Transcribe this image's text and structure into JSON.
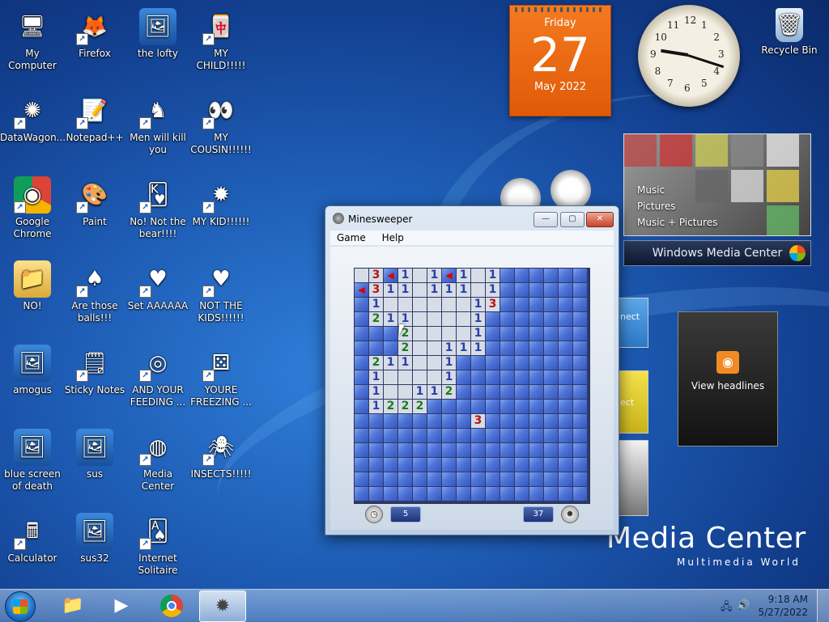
{
  "desktop_icons": [
    {
      "label": "My Computer",
      "icon": "computer-icon",
      "shortcut": false
    },
    {
      "label": "Firefox",
      "icon": "firefox-icon",
      "shortcut": true
    },
    {
      "label": "the lofty",
      "icon": "image-icon",
      "shortcut": false
    },
    {
      "label": "MY CHILD!!!!!",
      "icon": "mahjong-icon",
      "shortcut": true
    },
    {
      "label": "DataWagon...",
      "icon": "network-icon",
      "shortcut": true
    },
    {
      "label": "Notepad++",
      "icon": "notepad-icon",
      "shortcut": true
    },
    {
      "label": "Men will kill you",
      "icon": "chess-icon",
      "shortcut": true
    },
    {
      "label": "MY COUSIN!!!!!!",
      "icon": "eyes-icon",
      "shortcut": true
    },
    {
      "label": "Google Chrome",
      "icon": "chrome-icon",
      "shortcut": true
    },
    {
      "label": "Paint",
      "icon": "paint-icon",
      "shortcut": true
    },
    {
      "label": "No! Not the bear!!!!",
      "icon": "king-card-icon",
      "shortcut": true
    },
    {
      "label": "MY KID!!!!!!",
      "icon": "mine-icon",
      "shortcut": true
    },
    {
      "label": "NO!",
      "icon": "folder-icon",
      "shortcut": false
    },
    {
      "label": "Are those balls!!!",
      "icon": "spades-icon",
      "shortcut": true
    },
    {
      "label": "Set AAAAAA",
      "icon": "hearts-icon",
      "shortcut": true
    },
    {
      "label": "NOT THE KIDS!!!!!!",
      "icon": "hearts-cards-icon",
      "shortcut": true
    },
    {
      "label": "amogus",
      "icon": "image-icon",
      "shortcut": false
    },
    {
      "label": "Sticky Notes",
      "icon": "sticky-notes-icon",
      "shortcut": true
    },
    {
      "label": "AND YOUR FEEDING ...",
      "icon": "game-icon",
      "shortcut": true
    },
    {
      "label": "YOURE FREEZING ...",
      "icon": "dice-icon",
      "shortcut": true
    },
    {
      "label": "blue screen of death",
      "icon": "image-icon",
      "shortcut": false
    },
    {
      "label": "sus",
      "icon": "image-icon",
      "shortcut": false
    },
    {
      "label": "Media Center",
      "icon": "media-center-icon",
      "shortcut": true
    },
    {
      "label": "INSECTS!!!!!",
      "icon": "spider-icon",
      "shortcut": true
    },
    {
      "label": "Calculator",
      "icon": "calculator-icon",
      "shortcut": true
    },
    {
      "label": "sus32",
      "icon": "image-icon",
      "shortcut": false
    },
    {
      "label": "Internet Solitaire",
      "icon": "solitaire-icon",
      "shortcut": true
    }
  ],
  "recycle_bin": {
    "label": "Recycle Bin",
    "icon": "recycle-bin-icon"
  },
  "calendar": {
    "day_of_week": "Friday",
    "day": "27",
    "month_year": "May 2022"
  },
  "clock": {
    "numbers": [
      "12",
      "1",
      "2",
      "3",
      "4",
      "5",
      "6",
      "7",
      "8",
      "9",
      "10",
      "11"
    ],
    "hour": 9,
    "minute": 18
  },
  "media_center_gadget": {
    "items": [
      "Music",
      "Pictures",
      "Music + Pictures"
    ],
    "bar_label": "Windows Media Center"
  },
  "feed_gadget": {
    "label": "View headlines",
    "icon": "rss-icon"
  },
  "partial_gadgets": {
    "connect": "nect",
    "ect": "ect"
  },
  "wallpaper": {
    "title": "Media Center",
    "subtitle": "Multimedia World"
  },
  "minesweeper": {
    "title": "Minesweeper",
    "menu": [
      "Game",
      "Help"
    ],
    "buttons": {
      "minimize": "—",
      "maximize": "▢",
      "close": "✕"
    },
    "time": "5",
    "mines": "37",
    "rows": [
      "o3f1.o1f1.o1.......",
      "f3111.111o1......."
    ],
    "grid": [
      [
        "o",
        "3",
        "f",
        "1",
        "o",
        "1",
        "f",
        "1",
        "o",
        "1",
        "h",
        "h",
        "h",
        "h",
        "h",
        "h"
      ],
      [
        "f",
        "3",
        "1",
        "1",
        "o",
        "1",
        "1",
        "1",
        "o",
        "1",
        "h",
        "h",
        "h",
        "h",
        "h",
        "h"
      ],
      [
        "h",
        "1",
        "o",
        "o",
        "o",
        "o",
        "o",
        "o",
        "1",
        "3",
        "h",
        "h",
        "h",
        "h",
        "h",
        "h"
      ],
      [
        "h",
        "2",
        "1",
        "1",
        "o",
        "o",
        "o",
        "o",
        "1",
        "h",
        "h",
        "h",
        "h",
        "h",
        "h",
        "h"
      ],
      [
        "h",
        "h",
        "h",
        "2",
        "o",
        "o",
        "o",
        "o",
        "1",
        "h",
        "h",
        "h",
        "h",
        "h",
        "h",
        "h"
      ],
      [
        "h",
        "h",
        "h",
        "2",
        "o",
        "o",
        "1",
        "1",
        "1",
        "h",
        "h",
        "h",
        "h",
        "h",
        "h",
        "h"
      ],
      [
        "h",
        "2",
        "1",
        "1",
        "o",
        "o",
        "1",
        "h",
        "h",
        "h",
        "h",
        "h",
        "h",
        "h",
        "h",
        "h"
      ],
      [
        "h",
        "1",
        "o",
        "o",
        "o",
        "o",
        "1",
        "h",
        "h",
        "h",
        "h",
        "h",
        "h",
        "h",
        "h",
        "h"
      ],
      [
        "h",
        "1",
        "o",
        "o",
        "1",
        "1",
        "2",
        "h",
        "h",
        "h",
        "h",
        "h",
        "h",
        "h",
        "h",
        "h"
      ],
      [
        "h",
        "1",
        "2",
        "2",
        "2",
        "h",
        "h",
        "h",
        "h",
        "h",
        "h",
        "h",
        "h",
        "h",
        "h",
        "h"
      ],
      [
        "h",
        "h",
        "h",
        "h",
        "h",
        "h",
        "h",
        "h",
        "3",
        "h",
        "h",
        "h",
        "h",
        "h",
        "h",
        "h"
      ],
      [
        "h",
        "h",
        "h",
        "h",
        "h",
        "h",
        "h",
        "h",
        "h",
        "h",
        "h",
        "h",
        "h",
        "h",
        "h",
        "h"
      ],
      [
        "h",
        "h",
        "h",
        "h",
        "h",
        "h",
        "h",
        "h",
        "h",
        "h",
        "h",
        "h",
        "h",
        "h",
        "h",
        "h"
      ],
      [
        "h",
        "h",
        "h",
        "h",
        "h",
        "h",
        "h",
        "h",
        "h",
        "h",
        "h",
        "h",
        "h",
        "h",
        "h",
        "h"
      ],
      [
        "h",
        "h",
        "h",
        "h",
        "h",
        "h",
        "h",
        "h",
        "h",
        "h",
        "h",
        "h",
        "h",
        "h",
        "h",
        "h"
      ],
      [
        "h",
        "h",
        "h",
        "h",
        "h",
        "h",
        "h",
        "h",
        "h",
        "h",
        "h",
        "h",
        "h",
        "h",
        "h",
        "h"
      ]
    ]
  },
  "taskbar": {
    "start": "start-orb-icon",
    "pinned": [
      "explorer-icon",
      "media-player-icon",
      "chrome-icon",
      "minesweeper-icon"
    ],
    "time": "9:18 AM",
    "date": "5/27/2022"
  }
}
